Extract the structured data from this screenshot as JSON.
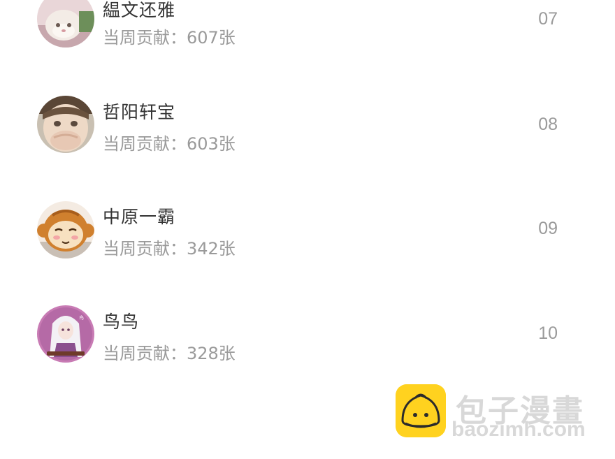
{
  "ranking": {
    "items": [
      {
        "rank": "07",
        "name": "緼文还雅",
        "contribution": "当周贡献：607张",
        "avatar": "cat-avatar"
      },
      {
        "rank": "08",
        "name": "哲阳轩宝",
        "contribution": "当周贡献：603张",
        "avatar": "child-avatar"
      },
      {
        "rank": "09",
        "name": "中原一霸",
        "contribution": "当周贡献：342张",
        "avatar": "monkey-avatar"
      },
      {
        "rank": "10",
        "name": "鸟鸟",
        "contribution": "当周贡献：328张",
        "avatar": "anime-avatar"
      }
    ]
  },
  "watermark": {
    "title": "包子漫畫",
    "url": "baozimh.com",
    "logo_color": "#ffd21f"
  }
}
